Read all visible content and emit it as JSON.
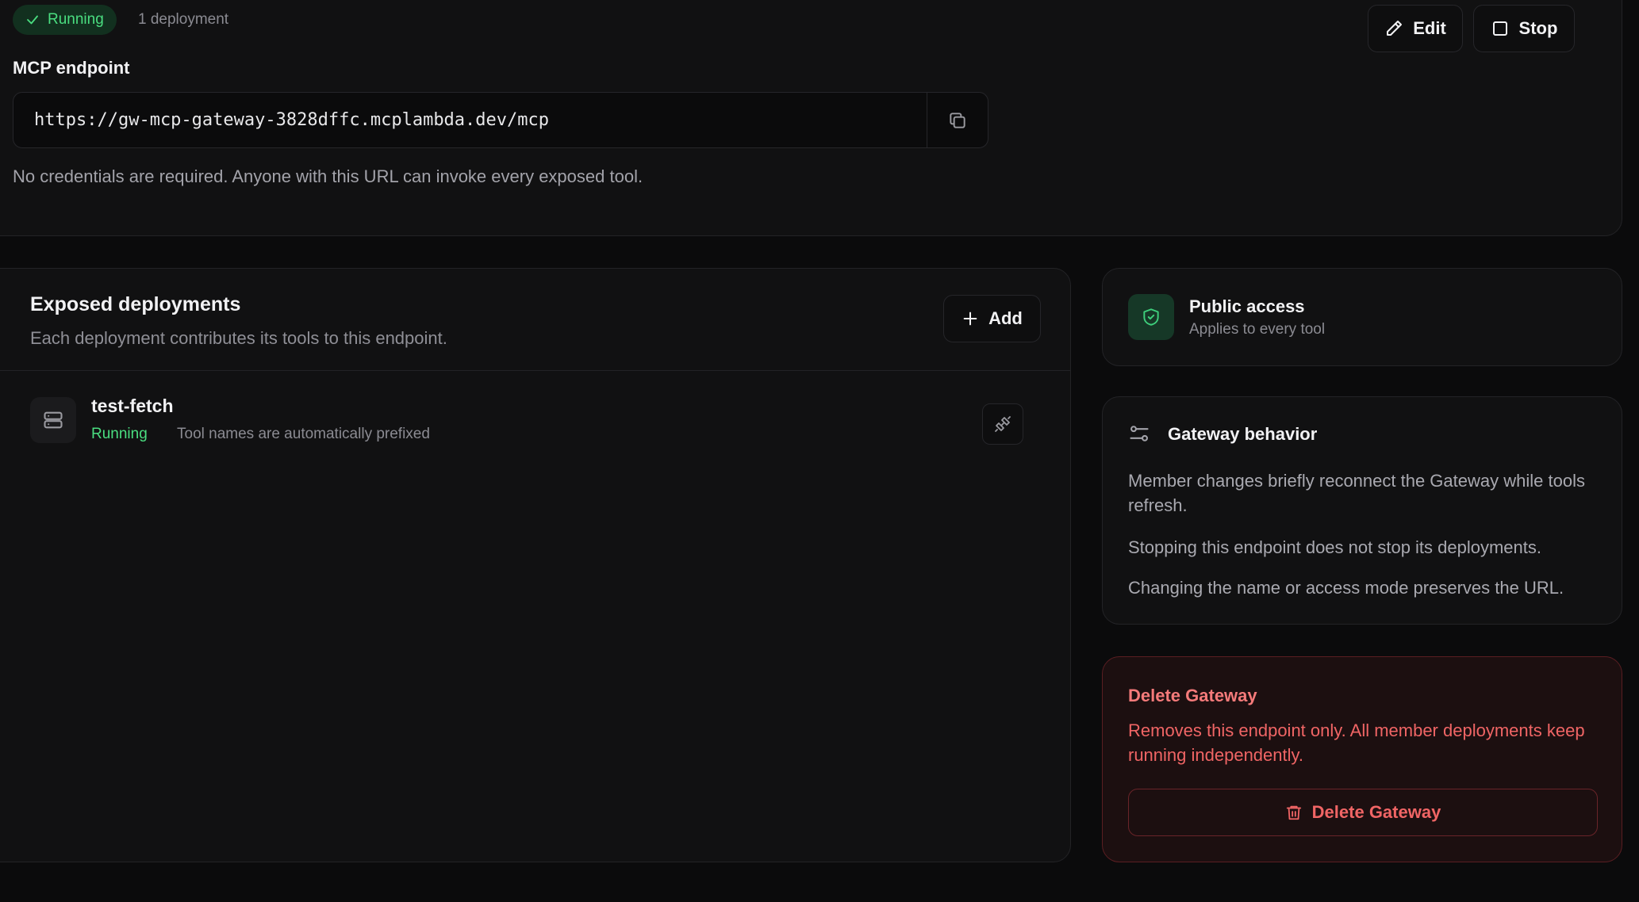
{
  "header": {
    "status": "Running",
    "deployment_count": "1 deployment",
    "edit_label": "Edit",
    "stop_label": "Stop"
  },
  "endpoint": {
    "label": "MCP endpoint",
    "url": "https://gw-mcp-gateway-3828dffc.mcplambda.dev/mcp",
    "note": "No credentials are required. Anyone with this URL can invoke every exposed tool."
  },
  "deployments": {
    "title": "Exposed deployments",
    "subtitle": "Each deployment contributes its tools to this endpoint.",
    "add_label": "Add",
    "items": [
      {
        "name": "test-fetch",
        "status": "Running",
        "note": "Tool names are automatically prefixed"
      }
    ]
  },
  "access": {
    "title": "Public access",
    "subtitle": "Applies to every tool"
  },
  "behavior": {
    "title": "Gateway behavior",
    "lines": [
      "Member changes briefly reconnect the Gateway while tools refresh.",
      "Stopping this endpoint does not stop its deployments.",
      "Changing the name or access mode preserves the URL."
    ]
  },
  "danger": {
    "title": "Delete Gateway",
    "description": "Removes this endpoint only. All member deployments keep running independently.",
    "button_label": "Delete Gateway"
  },
  "colors": {
    "background": "#0b0b0c",
    "card": "#111112",
    "success": "#4ade80",
    "danger": "#f06565"
  },
  "icons": [
    "check-icon",
    "pencil-icon",
    "square-icon",
    "copy-icon",
    "plus-icon",
    "server-icon",
    "unlink-icon",
    "shield-check-icon",
    "sliders-icon",
    "trash-icon"
  ]
}
